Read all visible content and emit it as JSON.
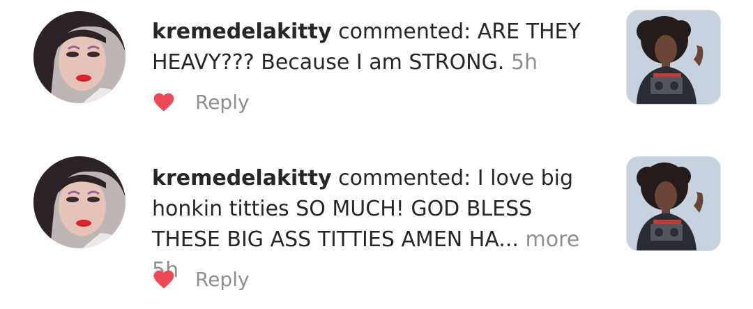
{
  "notifications": [
    {
      "username": "kremedelakitty",
      "action": "commented:",
      "comment": "ARE THEY HEAVY??? Because I am STRONG.",
      "more": "",
      "time": "5h",
      "reply_label": "Reply",
      "liked": true
    },
    {
      "username": "kremedelakitty",
      "action": "commented:",
      "comment": "I love big honkin titties SO MUCH! GOD BLESS THESE BIG ASS TITTIES AMEN HA...",
      "more": "more",
      "time": "5h",
      "reply_label": "Reply",
      "liked": true
    }
  ],
  "colors": {
    "heart": "#ed4956",
    "muted_text": "#8e8e8e",
    "primary_text": "#262626"
  }
}
